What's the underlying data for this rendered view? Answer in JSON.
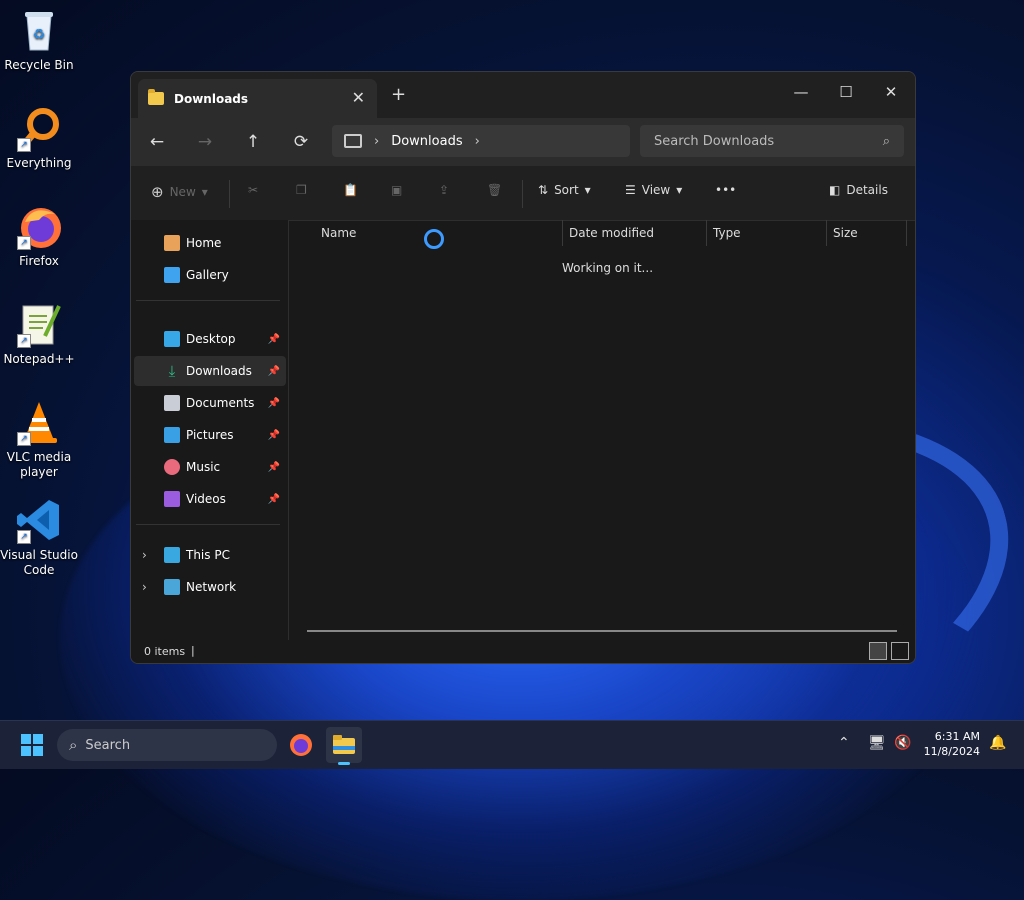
{
  "desktop": {
    "icons": [
      {
        "label": "Recycle Bin"
      },
      {
        "label": "Everything"
      },
      {
        "label": "Firefox"
      },
      {
        "label": "Notepad++"
      },
      {
        "label": "VLC media player"
      },
      {
        "label": "Visual Studio Code"
      }
    ]
  },
  "window": {
    "tab_title": "Downloads",
    "new_tab": "+",
    "controls": {
      "minimize": "—",
      "maximize": "☐",
      "close": "✕"
    },
    "nav": {
      "back": "←",
      "forward": "→",
      "up": "↑",
      "refresh": "⟳"
    },
    "address": {
      "crumb": "Downloads",
      "sep": "›"
    },
    "search": {
      "placeholder": "Search Downloads"
    },
    "toolbar": {
      "new_label": "New",
      "sort_label": "Sort",
      "view_label": "View",
      "more": "•••",
      "details_label": "Details"
    },
    "sidebar": {
      "quick": [
        {
          "label": "Home"
        },
        {
          "label": "Gallery"
        }
      ],
      "pinned": [
        {
          "label": "Desktop"
        },
        {
          "label": "Downloads"
        },
        {
          "label": "Documents"
        },
        {
          "label": "Pictures"
        },
        {
          "label": "Music"
        },
        {
          "label": "Videos"
        }
      ],
      "locations": [
        {
          "label": "This PC"
        },
        {
          "label": "Network"
        }
      ]
    },
    "columns": {
      "name": "Name",
      "date": "Date modified",
      "type": "Type",
      "size": "Size"
    },
    "status_message": "Working on it...",
    "statusbar": {
      "items": "0 items",
      "cursor": "|"
    }
  },
  "taskbar": {
    "search_label": "Search",
    "time": "6:31 AM",
    "date": "11/8/2024"
  },
  "colors": {
    "accent": "#4cc2ff",
    "spinner": "#3d9bff",
    "selected": "#2d2d2d"
  }
}
